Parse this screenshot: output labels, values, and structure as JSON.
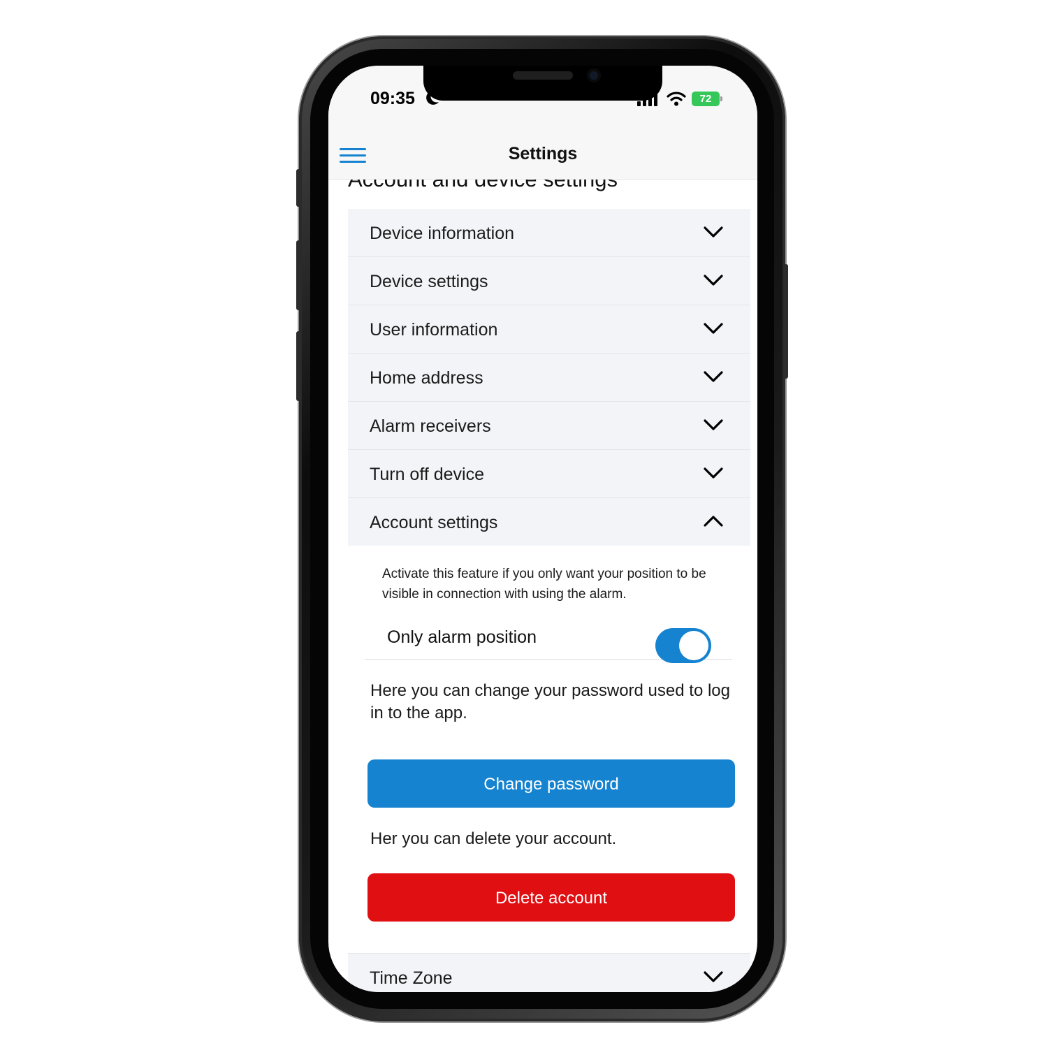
{
  "status_bar": {
    "time": "09:35",
    "moon_icon": "moon-icon",
    "signal_icon": "cellular-signal-icon",
    "wifi_icon": "wifi-icon",
    "battery_level": "72",
    "battery_color": "#35c759"
  },
  "header": {
    "title": "Settings",
    "menu_icon": "hamburger-menu-icon"
  },
  "section_title": "Account and device settings",
  "accordion": {
    "items": [
      {
        "label": "Device information",
        "expanded": false
      },
      {
        "label": "Device settings",
        "expanded": false
      },
      {
        "label": "User information",
        "expanded": false
      },
      {
        "label": "Home address",
        "expanded": false
      },
      {
        "label": "Alarm receivers",
        "expanded": false
      },
      {
        "label": "Turn off device",
        "expanded": false
      },
      {
        "label": "Account settings",
        "expanded": true
      }
    ]
  },
  "account_settings": {
    "privacy_note": "Activate this feature if you only want your position to be visible in connection with using the alarm.",
    "toggle_label": "Only alarm position",
    "toggle_on": true,
    "password_note": "Here you can change your password used to log in to the app.",
    "change_password_label": "Change password",
    "delete_note": "Her you can delete your account.",
    "delete_account_label": "Delete account"
  },
  "time_zone": {
    "label": "Time Zone",
    "expanded": false
  },
  "colors": {
    "accent_blue": "#1583cf",
    "danger_red": "#e00f12",
    "accordion_bg": "#f3f4f8"
  }
}
